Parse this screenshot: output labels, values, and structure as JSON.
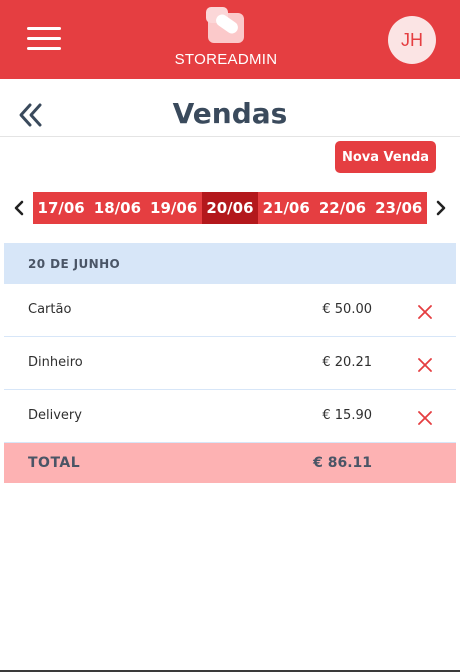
{
  "header": {
    "brand": "STOREADMIN",
    "avatar_initials": "JH",
    "menu_icon": "hamburger-menu-icon",
    "logo_icon": "store-logo-icon"
  },
  "page": {
    "title": "Vendas",
    "back_icon": "double-chevron-left-icon",
    "new_sale_label": "Nova Venda"
  },
  "date_nav": {
    "prev_icon": "chevron-left-icon",
    "next_icon": "chevron-right-icon",
    "dates": [
      "17/06",
      "18/06",
      "19/06",
      "20/06",
      "21/06",
      "22/06",
      "23/06"
    ],
    "selected": "20/06"
  },
  "sales": {
    "day_label": "20 DE JUNHO",
    "items": [
      {
        "method": "Cartão",
        "amount": "€ 50.00"
      },
      {
        "method": "Dinheiro",
        "amount": "€ 20.21"
      },
      {
        "method": "Delivery",
        "amount": "€ 15.90"
      }
    ],
    "delete_icon": "close-icon",
    "total_label": "TOTAL",
    "total_amount": "€ 86.11"
  },
  "colors": {
    "primary": "#e53e41",
    "primary_dark": "#b3181c",
    "day_header_bg": "#d7e6f8",
    "total_bg": "#fdb2b3",
    "title_text": "#3a4a5c"
  }
}
